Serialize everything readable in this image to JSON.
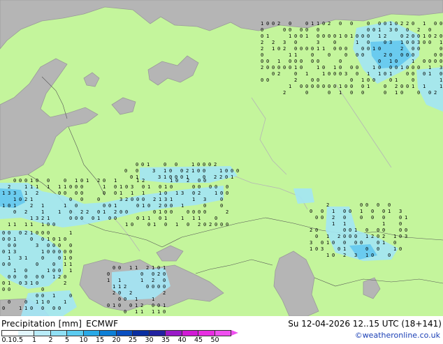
{
  "map": {
    "region": "Eastern Europe, Scandinavia and Western Russia",
    "land_color": "#c4f59c",
    "sea_color": "#b5b5b5",
    "coast_color": "#9a9a9a",
    "border_color": "#555555",
    "precip_light_color": "#a3e6f5",
    "precip_medium_color": "#64c8f0",
    "precip_heavy_color": "#2ea0e6",
    "value_digit_color": "#000000"
  },
  "footer": {
    "title": "Precipitation [mm]",
    "model": "ECMWF",
    "validity": "Su 12-04-2026 12..15 UTC (18+141)",
    "copyright": "©weatheronline.co.uk"
  },
  "scale": {
    "labels": [
      "0.1",
      "0.5",
      "1",
      "2",
      "5",
      "10",
      "15",
      "20",
      "25",
      "30",
      "35",
      "40",
      "45",
      "50"
    ],
    "colors": [
      "#ffffff",
      "#e2f6fc",
      "#b9ecf8",
      "#90e0f5",
      "#5ccbf0",
      "#2aa9e6",
      "#0d7fd6",
      "#0a4fc0",
      "#0a2ea0",
      "#2222a0",
      "#9a1ac8",
      "#d11ad6",
      "#e82ee2",
      "#f050f0"
    ]
  }
}
